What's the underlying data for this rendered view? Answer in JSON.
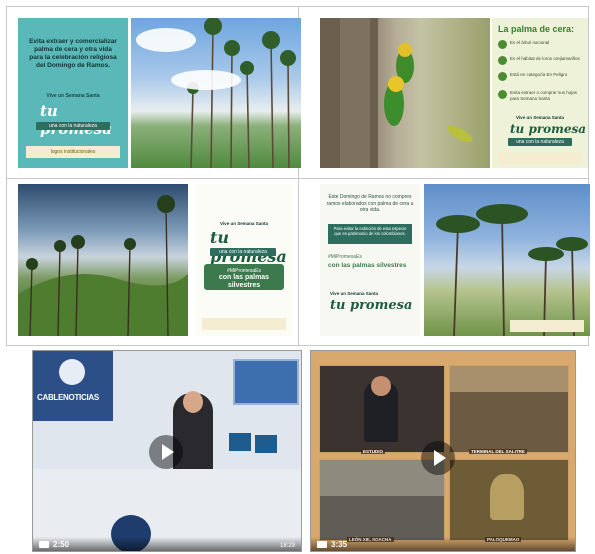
{
  "panel1": {
    "headline": "Evita extraer y comercializar palma de cera y otra vida para la celebración religiosa del Domingo de Ramos.",
    "campaign_line": "Vive un Semana Santa",
    "script_text": "tu promesa",
    "slogan": "una con la naturaleza",
    "logos": "logos institucionales"
  },
  "panel2": {
    "title": "La palma de cera:",
    "items": [
      "Es el árbol nacional",
      "Es el hábitat de loros orejiamarillos",
      "Está en categoría En Peligro",
      "Evita extraer o comprar sus hojas para Semana Santa"
    ],
    "campaign_line": "Vive un Semana Santa",
    "script_text": "tu promesa",
    "slogan": "una con la naturaleza"
  },
  "panel3": {
    "campaign_line": "Vive un Semana Santa",
    "script_text": "tu promesa",
    "slogan": "una con la naturaleza",
    "hashtag": "#MiPromesaEs",
    "message": "con las palmas silvestres"
  },
  "panel4": {
    "intro": "Este Domingo de Ramos no compres ramos elaborados con palma de cera u otra vida.",
    "box_text": "Para evitar la extinción de esta especie que es patrimonio de los colombianos.",
    "hashtag": "#MiPromesaEs",
    "message": "con las palmas silvestres",
    "campaign_line": "Vive un Semana Santa",
    "script_text": "tu promesa"
  },
  "video1": {
    "channel": "CABLENOTICIAS",
    "duration": "2:50",
    "end_time": "18:29"
  },
  "video2": {
    "captions": [
      "ESTUDIO",
      "TERMINAL DEL SALITRE",
      "LEÓN XIII, SOACHA",
      "PALOQUEMAO"
    ],
    "duration": "3:35"
  }
}
